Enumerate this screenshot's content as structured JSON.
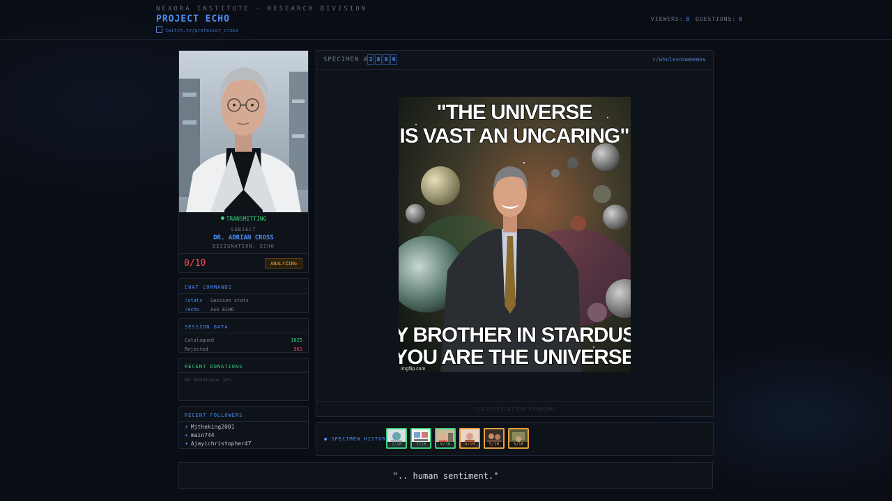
{
  "header": {
    "org": "NEXORA INSTITUTE - RESEARCH DIVISION",
    "project": "PROJECT ECHO",
    "channel": "twitch.tv/professor_cross",
    "viewers_label": "VIEWERS:",
    "viewers": "0",
    "questions_label": "QUESTIONS:",
    "questions": "0"
  },
  "subject": {
    "status": "TRANSMITTING",
    "label": "SUBJECT",
    "name": "DR. ADRIAN CROSS",
    "designation": "DESIGNATION: ECHO",
    "score": "0/10",
    "state": "ANALYZING"
  },
  "chat_commands": {
    "title": "CHAT COMMANDS",
    "items": [
      {
        "cmd": "!stats",
        "desc": "Session stats"
      },
      {
        "cmd": "!echo",
        "desc": "Ask ECHO"
      }
    ]
  },
  "session_data": {
    "title": "SESSION DATA",
    "catalogued_label": "Catalogued",
    "catalogued": "1825",
    "rejected_label": "Rejected",
    "rejected": "561"
  },
  "donations": {
    "title": "RECENT DONATIONS",
    "empty": "No donations yet"
  },
  "followers": {
    "title": "RECENT FOLLOWERS",
    "items": [
      "Mjtheking2001",
      "main744",
      "Ajayichristopher47"
    ]
  },
  "specimen": {
    "label": "SPECIMEN #",
    "digits": [
      "2",
      "8",
      "0",
      "9"
    ],
    "source": "r/wholesomememes",
    "meme_top_1": "\"THE UNIVERSE",
    "meme_top_2": "IS VAST AN UNCARING\"",
    "meme_bottom_1": "MY BROTHER IN STARDUST,",
    "meme_bottom_2": "YOU ARE THE UNIVERSE",
    "watermark": "imgflip.com",
    "classification": "CLASSIFICATION PENDING"
  },
  "history": {
    "label": "SPECIMEN HISTORY",
    "items": [
      {
        "score": "7/10",
        "color": "#3ad07e"
      },
      {
        "score": "7/10",
        "color": "#3ad07e"
      },
      {
        "score": "8/10",
        "color": "#3ad07e"
      },
      {
        "score": "4/10",
        "color": "#e8a13b"
      },
      {
        "score": "5/10",
        "color": "#e8a13b"
      },
      {
        "score": "5/10",
        "color": "#e8a13b"
      }
    ]
  },
  "quote": "\".. human sentiment.\""
}
